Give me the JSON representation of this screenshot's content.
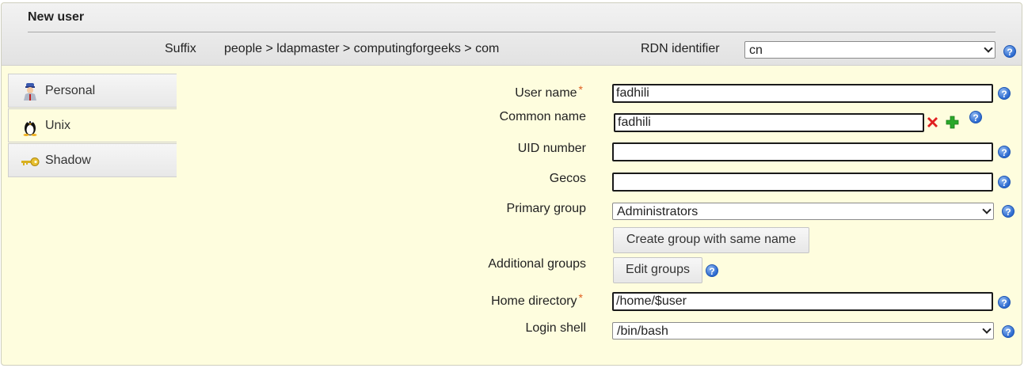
{
  "header": {
    "title": "New user",
    "suffix_label": "Suffix",
    "suffix_value": "people > ldapmaster > computingforgeeks > com",
    "rdn_label": "RDN identifier",
    "rdn_value": "cn"
  },
  "tabs": [
    {
      "label": "Personal",
      "icon": "person-icon"
    },
    {
      "label": "Unix",
      "icon": "tux-penguin-icon"
    },
    {
      "label": "Shadow",
      "icon": "key-icon"
    }
  ],
  "form": {
    "user_name": {
      "label": "User name",
      "value": "fadhili",
      "required": "*"
    },
    "common_name": {
      "label": "Common name",
      "value": "fadhili"
    },
    "uid_number": {
      "label": "UID number",
      "value": ""
    },
    "gecos": {
      "label": "Gecos",
      "value": ""
    },
    "primary_group": {
      "label": "Primary group",
      "value": "Administrators"
    },
    "create_group_button": "Create group with same name",
    "additional_groups": {
      "label": "Additional groups",
      "button": "Edit groups"
    },
    "home_directory": {
      "label": "Home directory",
      "value": "/home/$user",
      "required": "*"
    },
    "login_shell": {
      "label": "Login shell",
      "value": "/bin/bash"
    }
  },
  "help_glyph": "?",
  "colors": {
    "panel_bg": "#fefdde",
    "help_blue": "#2c6ad0",
    "required_orange": "#e06020",
    "remove_red": "#e02020",
    "add_green": "#2aa82a"
  }
}
